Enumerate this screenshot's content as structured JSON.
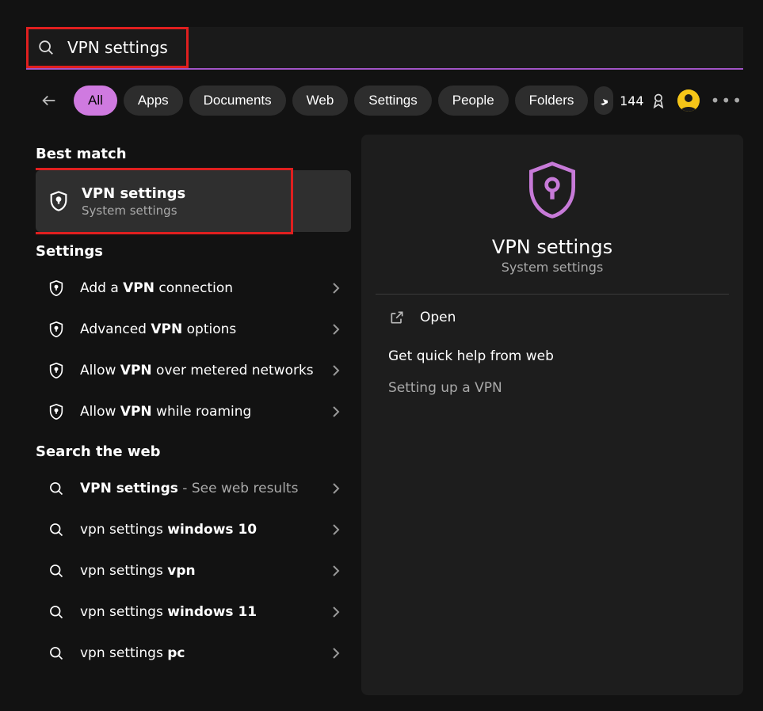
{
  "search": {
    "value": "VPN settings"
  },
  "filters": [
    "All",
    "Apps",
    "Documents",
    "Web",
    "Settings",
    "People",
    "Folders"
  ],
  "points": "144",
  "sections": {
    "bestMatchLabel": "Best match",
    "bestMatch": {
      "title": "VPN settings",
      "subtitle": "System settings"
    },
    "settingsLabel": "Settings",
    "settingsItems": [
      {
        "prefix": "Add a ",
        "bold": "VPN",
        "suffix": " connection"
      },
      {
        "prefix": "Advanced ",
        "bold": "VPN",
        "suffix": " options"
      },
      {
        "prefix": "Allow ",
        "bold": "VPN",
        "suffix": " over metered networks"
      },
      {
        "prefix": "Allow ",
        "bold": "VPN",
        "suffix": " while roaming"
      }
    ],
    "webLabel": "Search the web",
    "webItems": [
      {
        "prefix": "",
        "bold": "VPN settings",
        "suffix": "",
        "secondary": " - See web results"
      },
      {
        "prefix": "vpn settings ",
        "bold": "windows 10",
        "suffix": ""
      },
      {
        "prefix": "vpn settings ",
        "bold": "vpn",
        "suffix": ""
      },
      {
        "prefix": "vpn settings ",
        "bold": "windows 11",
        "suffix": ""
      },
      {
        "prefix": "vpn settings ",
        "bold": "pc",
        "suffix": ""
      }
    ]
  },
  "preview": {
    "title": "VPN settings",
    "subtitle": "System settings",
    "openLabel": "Open",
    "webHelpHeading": "Get quick help from web",
    "webHelpLink": "Setting up a VPN"
  }
}
